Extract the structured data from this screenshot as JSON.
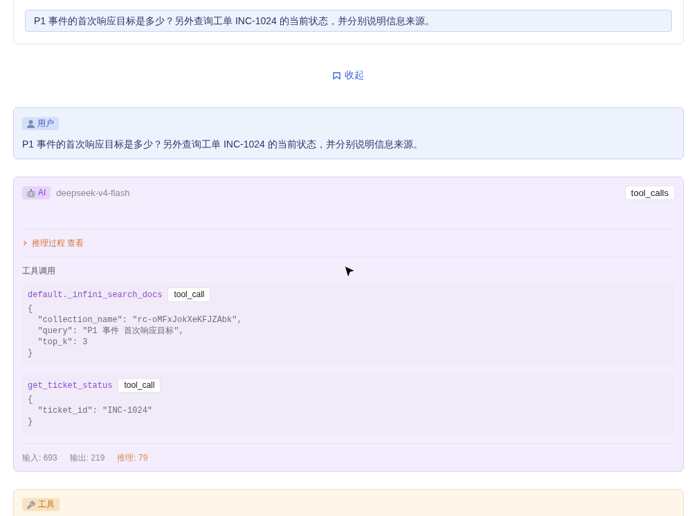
{
  "context_card": {
    "question": "P1 事件的首次响应目标是多少？另外查询工单 INC-1024 的当前状态，并分别说明信息来源。"
  },
  "collapse_link": {
    "label": "收起"
  },
  "messages": [
    {
      "kind": "user",
      "role": "用户",
      "text": "P1 事件的首次响应目标是多少？另外查询工单 INC-1024 的当前状态，并分别说明信息来源。"
    },
    {
      "kind": "ai",
      "role": "AI",
      "model": "deepseek-v4-flash",
      "type_badge": "tool_calls",
      "reasoning": {
        "label": "推理过程 查看",
        "expanded": false
      },
      "tool_calls_heading": "工具调用",
      "tool_calls": [
        {
          "name": "default._infini_search_docs",
          "type_badge": "tool_call",
          "arguments": "{\n  \"collection_name\": \"rc-oMFxJokXeKFJZAbk\",\n  \"query\": \"P1 事件 首次响应目标\",\n  \"top_k\": 3\n}"
        },
        {
          "name": "get_ticket_status",
          "type_badge": "tool_call",
          "arguments": "{\n  \"ticket_id\": \"INC-1024\"\n}"
        }
      ],
      "usage": [
        {
          "kind": "input",
          "text": "输入: 693"
        },
        {
          "kind": "output",
          "text": "输出: 219"
        },
        {
          "kind": "reasoning",
          "text": "推理: 79"
        }
      ]
    },
    {
      "kind": "tool",
      "role": "工具"
    }
  ]
}
